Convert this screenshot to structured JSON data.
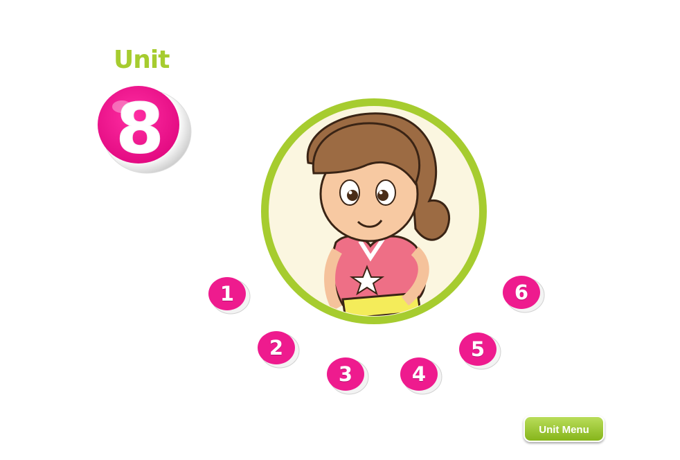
{
  "header": {
    "unit_label": "Unit",
    "unit_number": "8"
  },
  "lessons": [
    {
      "label": "1"
    },
    {
      "label": "2"
    },
    {
      "label": "3"
    },
    {
      "label": "4"
    },
    {
      "label": "5"
    },
    {
      "label": "6"
    }
  ],
  "footer": {
    "unit_menu_label": "Unit Menu"
  },
  "colors": {
    "accent_green": "#a6cc2f",
    "bubble_pink": "#ee1b8e",
    "portrait_bg": "#fbf6e0"
  },
  "icons": {
    "portrait": "girl-character-illustration"
  }
}
